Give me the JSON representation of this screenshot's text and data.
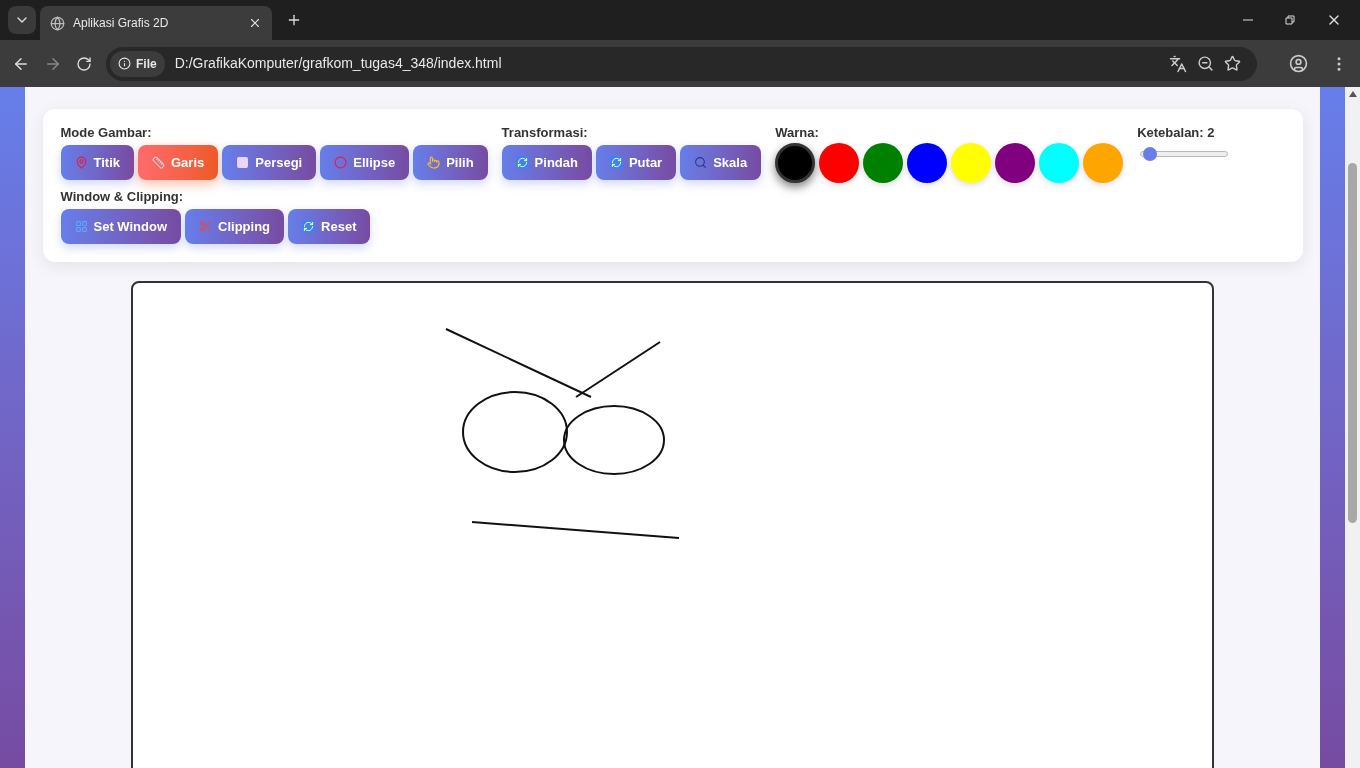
{
  "browser": {
    "tab_title": "Aplikasi Grafis 2D",
    "url_chip": "File",
    "url": "D:/GrafikaKomputer/grafkom_tugas4_348/index.html"
  },
  "groups": [
    {
      "kind": "buttons",
      "label": "Mode Gambar:",
      "buttons": [
        {
          "label": "Titik",
          "kind": "pin",
          "selected": false
        },
        {
          "label": "Garis",
          "kind": "ruler",
          "selected": true
        },
        {
          "label": "Persegi",
          "kind": "square",
          "selected": false
        },
        {
          "label": "Ellipse",
          "kind": "ring",
          "selected": false
        },
        {
          "label": "Pilih",
          "kind": "hand",
          "selected": false
        }
      ]
    },
    {
      "kind": "buttons",
      "label": "Transformasi:",
      "buttons": [
        {
          "label": "Pindah",
          "kind": "refresh",
          "selected": false
        },
        {
          "label": "Putar",
          "kind": "refresh",
          "selected": false
        },
        {
          "label": "Skala",
          "kind": "search",
          "selected": false
        }
      ]
    },
    {
      "kind": "colors",
      "label": "Warna:",
      "swatches": [
        {
          "color": "#000000",
          "selected": true
        },
        {
          "color": "#ff0000",
          "selected": false
        },
        {
          "color": "#008000",
          "selected": false
        },
        {
          "color": "#0000ff",
          "selected": false
        },
        {
          "color": "#ffff00",
          "selected": false
        },
        {
          "color": "#800080",
          "selected": false
        },
        {
          "color": "#00ffff",
          "selected": false
        },
        {
          "color": "#ffa500",
          "selected": false
        }
      ]
    },
    {
      "kind": "slider",
      "label": "Ketebalan: 2",
      "level": 0.11
    },
    {
      "kind": "buttons",
      "label": "Window & Clipping:",
      "buttons": [
        {
          "label": "Set Window",
          "kind": "window",
          "selected": false
        },
        {
          "label": "Clipping",
          "kind": "scissors",
          "selected": false
        },
        {
          "label": "Reset",
          "kind": "refresh",
          "selected": false
        }
      ]
    }
  ]
}
